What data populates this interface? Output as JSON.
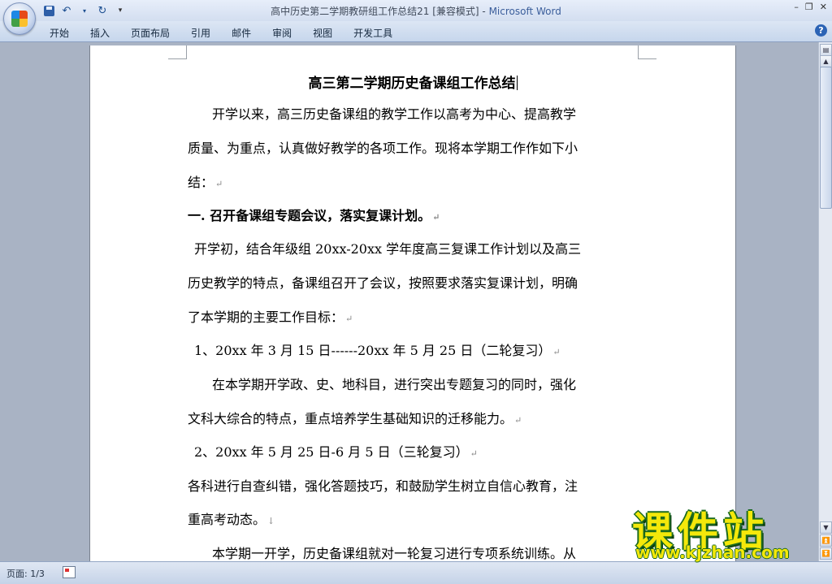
{
  "window": {
    "doc_name": "高中历史第二学期教研组工作总结21 [兼容模式] - ",
    "app_name": "Microsoft Word",
    "controls": [
      "–",
      "❐",
      "✕"
    ]
  },
  "ribbon": {
    "tabs": [
      "开始",
      "插入",
      "页面布局",
      "引用",
      "邮件",
      "审阅",
      "视图",
      "开发工具"
    ],
    "help": "?"
  },
  "document": {
    "title": "高三第二学期历史备课组工作总结",
    "lines": [
      {
        "text": "开学以来，高三历史备课组的教学工作以高考为中心、提高教学",
        "mark": ""
      },
      {
        "text": "质量、为重点，认真做好教学的各项工作。现将本学期工作作如下小",
        "mark": ""
      },
      {
        "text": "结：",
        "mark": "↵"
      },
      {
        "text": "一. 召开备课组专题会议，落实复课计划。",
        "mark": "↵"
      },
      {
        "text": "开学初，结合年级组 20xx-20xx 学年度高三复课工作计划以及高三",
        "mark": ""
      },
      {
        "text": "历史教学的特点，备课组召开了会议，按照要求落实复课计划，明确",
        "mark": ""
      },
      {
        "text": "了本学期的主要工作目标：",
        "mark": "↵"
      },
      {
        "text": "1、20xx 年 3 月 15 日------20xx 年 5 月 25 日（二轮复习）",
        "mark": "↵"
      },
      {
        "text": "在本学期开学政、史、地科目，进行突出专题复习的同时，强化",
        "mark": ""
      },
      {
        "text": "文科大综合的特点，重点培养学生基础知识的迁移能力。",
        "mark": "↵"
      },
      {
        "text": "2、20xx 年 5 月 25 日-6 月 5 日（三轮复习）",
        "mark": "↵"
      },
      {
        "text": "各科进行自查纠错，强化答题技巧，和鼓励学生树立自信心教育，注",
        "mark": ""
      },
      {
        "text": "重高考动态。",
        "mark": "↓"
      },
      {
        "text": "本学期一开学，历史备课组就对一轮复习进行专项系统训练。从",
        "mark": ""
      }
    ]
  },
  "status": {
    "page": "页面: 1/3"
  },
  "watermark": {
    "main": "课件站",
    "url": "www.kjzhan.com"
  }
}
